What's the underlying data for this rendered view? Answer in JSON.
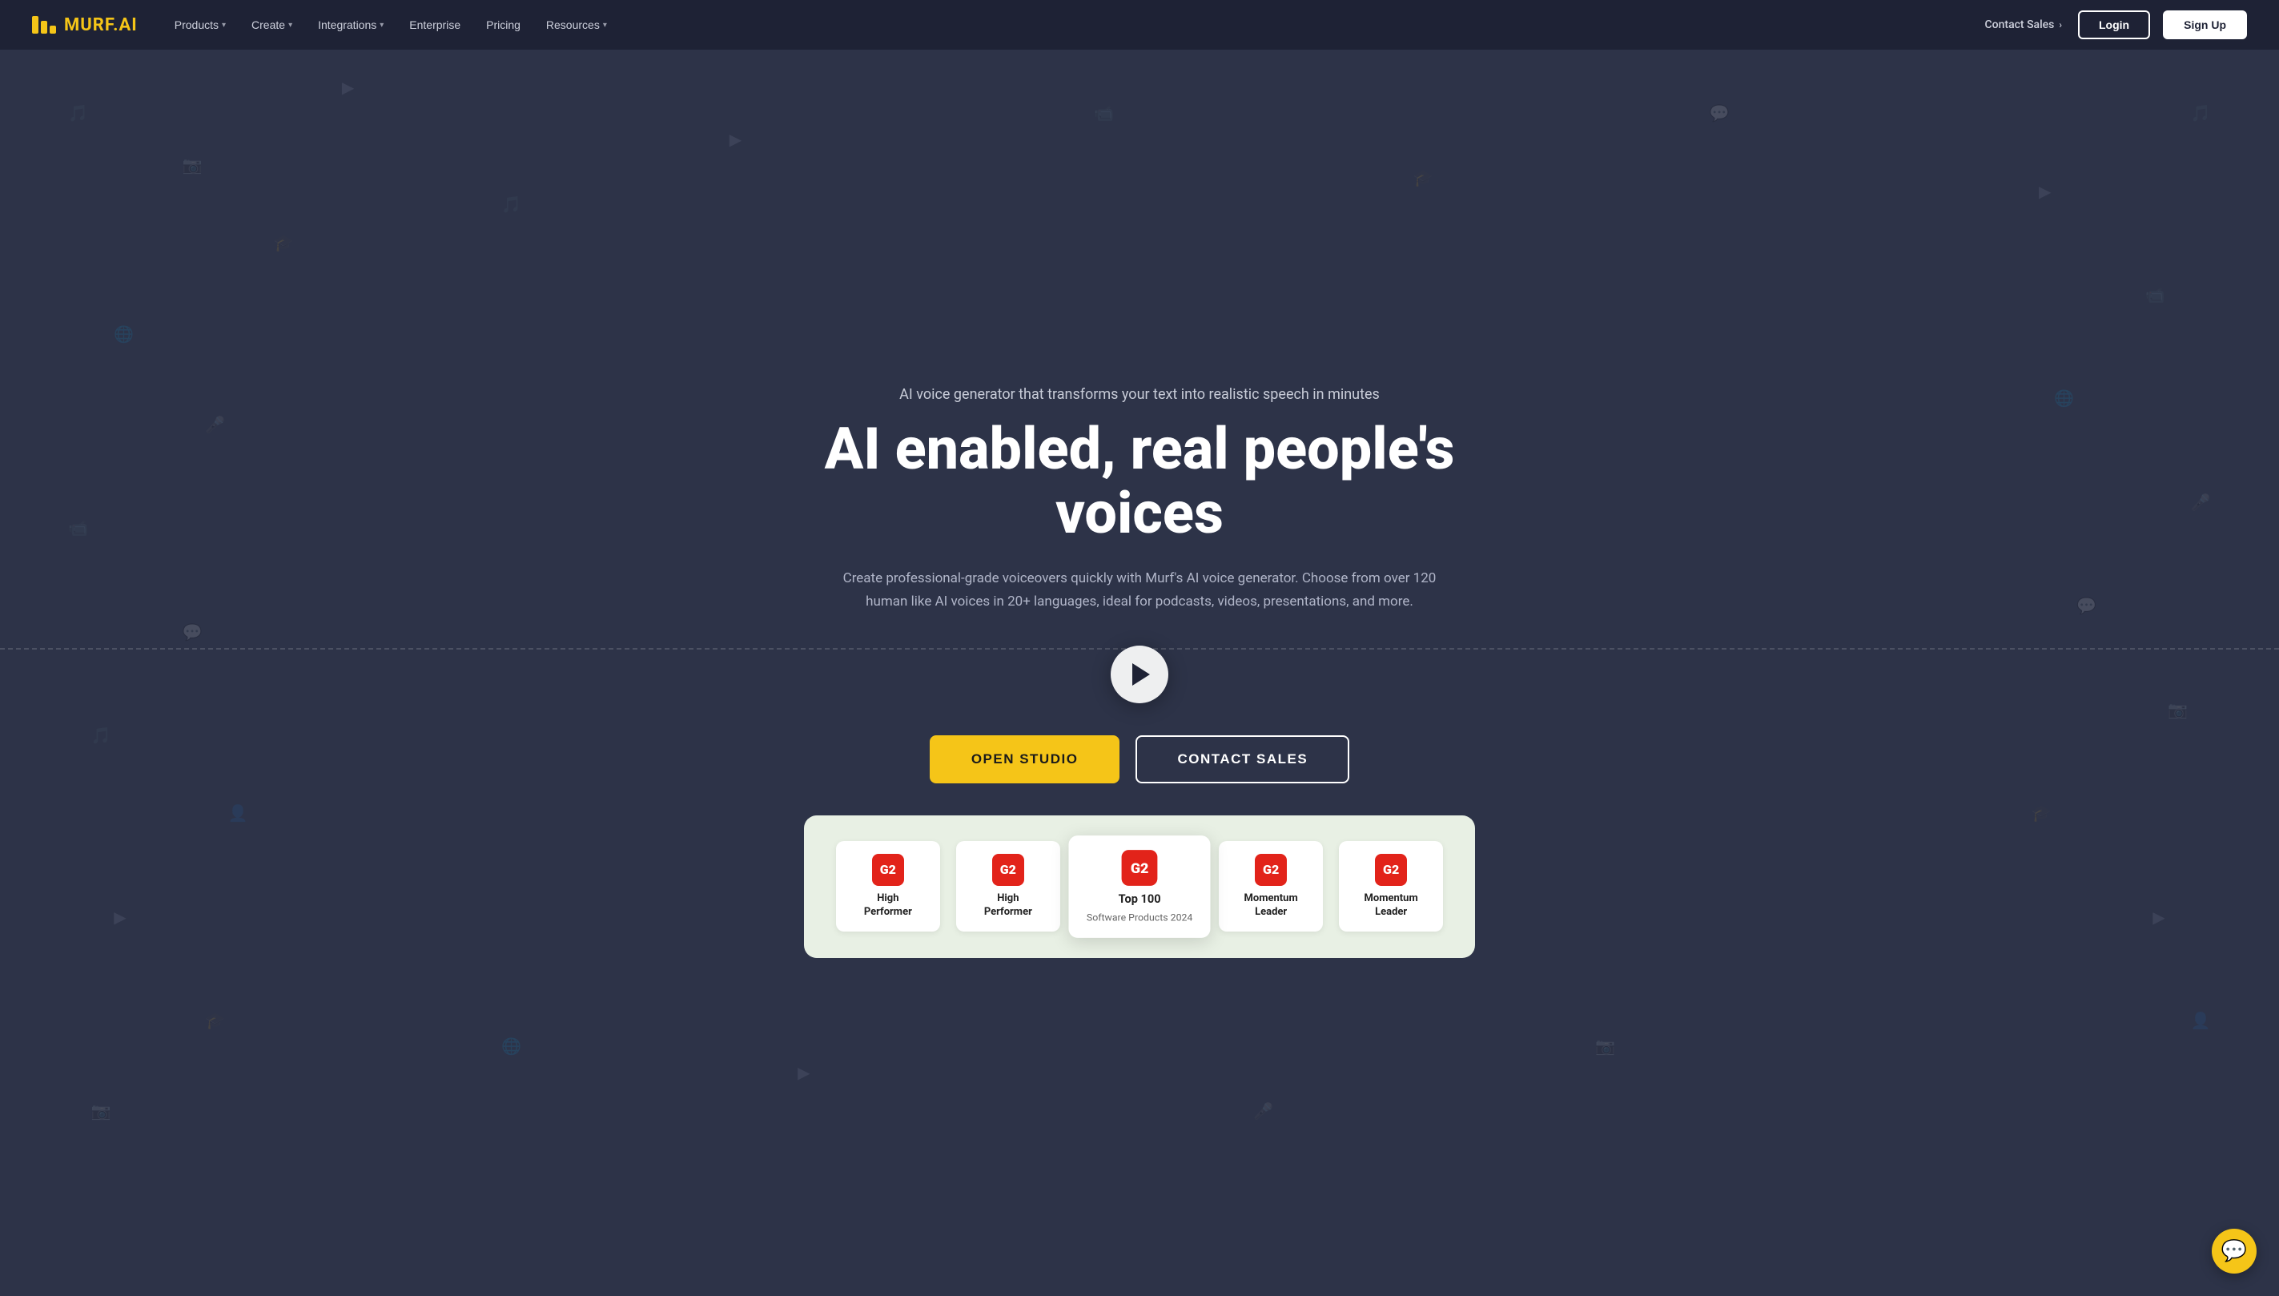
{
  "nav": {
    "logo_text": "MURF",
    "logo_suffix": ".AI",
    "links": [
      {
        "label": "Products",
        "has_dropdown": true
      },
      {
        "label": "Create",
        "has_dropdown": true
      },
      {
        "label": "Integrations",
        "has_dropdown": true
      },
      {
        "label": "Enterprise",
        "has_dropdown": false
      },
      {
        "label": "Pricing",
        "has_dropdown": false
      },
      {
        "label": "Resources",
        "has_dropdown": true
      }
    ],
    "contact_sales": "Contact Sales",
    "login": "Login",
    "signup": "Sign Up"
  },
  "hero": {
    "subtitle": "AI voice generator that transforms your text into realistic speech in minutes",
    "title": "AI enabled, real people's voices",
    "description": "Create professional-grade voiceovers quickly with Murf's AI voice generator. Choose from over 120 human like AI voices in 20+ languages, ideal for podcasts, videos, presentations, and more.",
    "cta_primary": "OPEN STUDIO",
    "cta_secondary": "CONTACT SALES"
  },
  "awards": [
    {
      "badge": "G2",
      "title": "High\nPerformer",
      "subtitle": "",
      "featured": false
    },
    {
      "badge": "G2",
      "title": "High\nPerformer",
      "subtitle": "",
      "featured": false
    },
    {
      "badge": "G2",
      "title": "Top 100",
      "subtitle": "Software Products 2024",
      "featured": true
    },
    {
      "badge": "G2",
      "title": "Momentum\nLeader",
      "subtitle": "",
      "featured": false
    },
    {
      "badge": "G2",
      "title": "Momentum\nLeader",
      "subtitle": "",
      "featured": false
    }
  ],
  "chat": {
    "icon": "💬"
  }
}
